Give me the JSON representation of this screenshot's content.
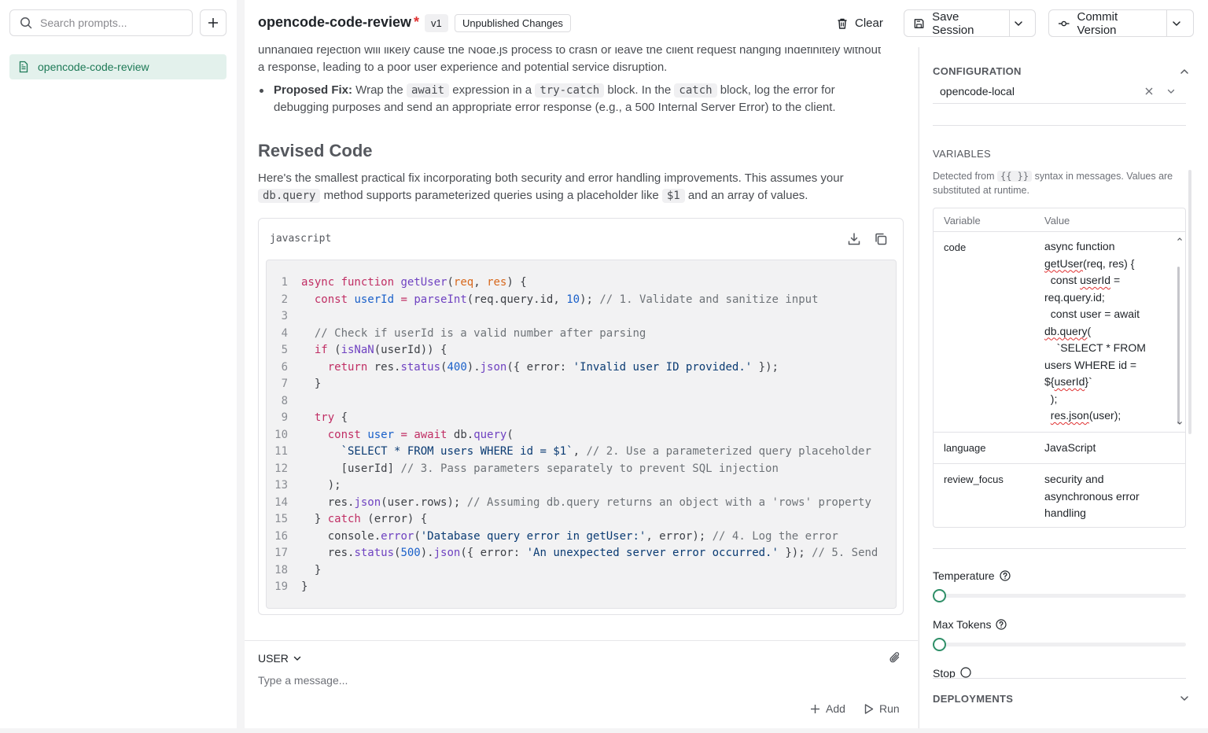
{
  "sidebar": {
    "search_placeholder": "Search prompts...",
    "items": [
      {
        "label": "opencode-code-review"
      }
    ]
  },
  "header": {
    "title": "opencode-code-review",
    "modified_marker": "*",
    "version": "v1",
    "status": "Unpublished Changes",
    "clear_label": "Clear",
    "save_label": "Save Session",
    "commit_label": "Commit Version"
  },
  "content": {
    "top_text": "unhandled rejection will likely cause the Node.js process to crash or leave the client request hanging indefinitely without a response, leading to a poor user experience and potential service disruption.",
    "fix_label": "Proposed Fix:",
    "fix_t1": " Wrap the ",
    "fix_c1": "await",
    "fix_t2": " expression in a ",
    "fix_c2": "try-catch",
    "fix_t3": " block. In the ",
    "fix_c3": "catch",
    "fix_t4": " block, log the error for debugging purposes and send an appropriate error response (e.g., a 500 Internal Server Error) to the client.",
    "heading": "Revised Code",
    "desc_t1": "Here's the smallest practical fix incorporating both security and error handling improvements. This assumes your ",
    "desc_c1": "db.query",
    "desc_t2": " method supports parameterized queries using a placeholder like ",
    "desc_c2": "$1",
    "desc_t3": " and an array of values."
  },
  "code_block": {
    "language": "javascript",
    "lines": [
      "1",
      "2",
      "3",
      "4",
      "5",
      "6",
      "7",
      "8",
      "9",
      "10",
      "11",
      "12",
      "13",
      "14",
      "15",
      "16",
      "17",
      "18",
      "19"
    ]
  },
  "composer": {
    "role": "USER",
    "placeholder": "Type a message...",
    "add_label": "Add",
    "run_label": "Run"
  },
  "right_panel": {
    "configuration_title": "CONFIGURATION",
    "configuration_value": "opencode-local",
    "variables_title": "VARIABLES",
    "variables_desc_t1": "Detected from ",
    "variables_desc_code": "{{ }}",
    "variables_desc_t2": " syntax in messages. Values are substituted at runtime.",
    "col_variable": "Variable",
    "col_value": "Value",
    "variables": [
      {
        "name": "code"
      },
      {
        "name": "language",
        "value": "JavaScript"
      },
      {
        "name": "review_focus",
        "value": "security and asynchronous error handling"
      }
    ],
    "temperature_label": "Temperature",
    "max_tokens_label": "Max Tokens",
    "stop_label": "Stop",
    "deployments_title": "DEPLOYMENTS",
    "temperature_value": 0,
    "max_tokens_value": 0
  },
  "colors": {
    "accent": "#2f8f68",
    "selected_bg": "#e3f1ec",
    "error_marker": "#e03131"
  }
}
